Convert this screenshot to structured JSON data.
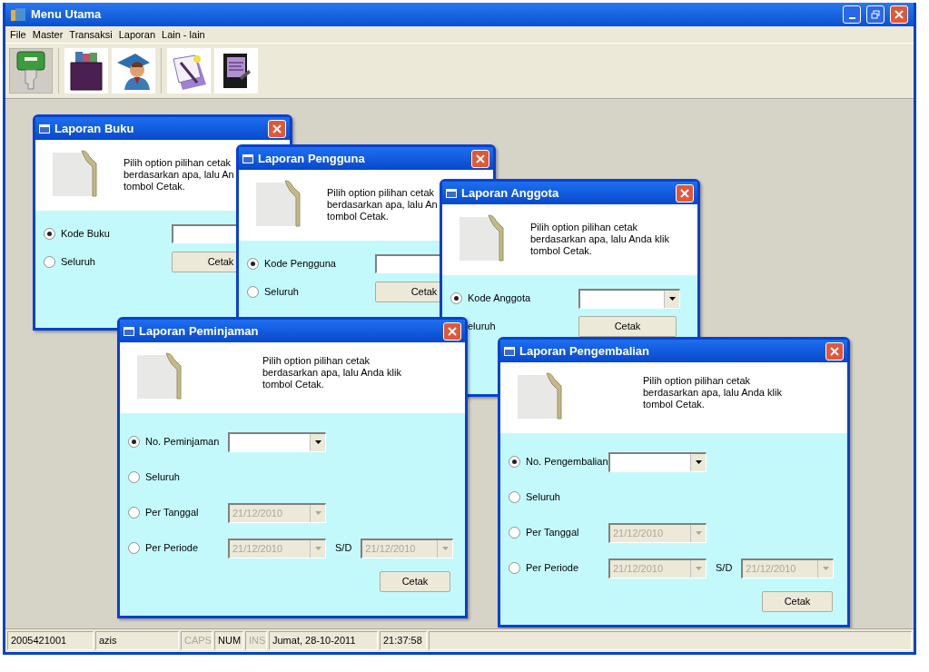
{
  "window": {
    "title": "Menu Utama"
  },
  "menu": [
    "File",
    "Master",
    "Transaksi",
    "Laporan",
    "Lain - lain"
  ],
  "toolbar": [
    {
      "kind": "key",
      "pressed": true
    },
    {
      "kind": "box",
      "pressed": false
    },
    {
      "kind": "person",
      "pressed": false
    },
    {
      "kind": "document",
      "pressed": false
    },
    {
      "kind": "book",
      "pressed": false
    }
  ],
  "dialogs": [
    {
      "kind": "compact",
      "title": "Laporan Buku",
      "description": "Pilih option pilihan cetak\nberdasarkan apa, lalu An\ntombol Cetak.",
      "options": [
        {
          "label": "Kode Buku",
          "selected": true,
          "fields": [
            {
              "kind": "text",
              "disabled": false
            }
          ]
        },
        {
          "label": "Seluruh",
          "selected": false
        }
      ],
      "button": "Cetak"
    },
    {
      "kind": "compact",
      "title": "Laporan Pengguna",
      "description": "Pilih option pilihan cetak\nberdasarkan apa, lalu An\ntombol Cetak.",
      "options": [
        {
          "label": "Kode Pengguna",
          "selected": true,
          "fields": [
            {
              "kind": "text",
              "disabled": false
            }
          ]
        },
        {
          "label": "Seluruh",
          "selected": false
        }
      ],
      "button": "Cetak"
    },
    {
      "kind": "compact",
      "title": "Laporan Anggota",
      "description": "Pilih option pilihan cetak\nberdasarkan apa, lalu Anda klik\ntombol Cetak.",
      "options": [
        {
          "label": "Kode Anggota",
          "selected": true,
          "fields": [
            {
              "kind": "combo",
              "disabled": false
            }
          ]
        },
        {
          "label": "eluruh"
        }
      ],
      "button": "Cetak"
    },
    {
      "kind": "wide",
      "title": "Laporan Peminjaman",
      "description": "Pilih option pilihan cetak\nberdasarkan apa, lalu Anda klik\ntombol Cetak.",
      "options": [
        {
          "label": "No. Peminjaman",
          "selected": true,
          "fields": [
            {
              "kind": "combo",
              "disabled": false
            }
          ]
        },
        {
          "label": "Seluruh",
          "selected": false
        },
        {
          "label": "Per Tanggal",
          "selected": false,
          "fields": [
            {
              "kind": "date",
              "value": "21/12/2010",
              "disabled": true
            }
          ]
        },
        {
          "label": "Per Periode",
          "selected": false,
          "fields": [
            {
              "kind": "date",
              "value": "21/12/2010",
              "disabled": true
            }
          ],
          "range_label": "S/D",
          "range_fields": [
            {
              "kind": "date",
              "value": "21/12/2010",
              "disabled": true
            }
          ]
        }
      ],
      "button": "Cetak"
    },
    {
      "kind": "wide",
      "title": "Laporan Pengembalian",
      "description": "Pilih option pilihan cetak\nberdasarkan apa, lalu Anda klik\ntombol Cetak.",
      "options": [
        {
          "label": "No. Pengembalian",
          "selected": true,
          "fields": [
            {
              "kind": "combo",
              "disabled": false
            }
          ]
        },
        {
          "label": "Seluruh",
          "selected": false
        },
        {
          "label": "Per Tanggal",
          "selected": false,
          "fields": [
            {
              "kind": "date",
              "value": "21/12/2010",
              "disabled": true
            }
          ]
        },
        {
          "label": "Per Periode",
          "selected": false,
          "fields": [
            {
              "kind": "date",
              "value": "21/12/2010",
              "disabled": true
            }
          ],
          "range_label": "S/D",
          "range_fields": [
            {
              "kind": "date",
              "value": "21/12/2010",
              "disabled": true
            }
          ]
        }
      ],
      "button": "Cetak"
    }
  ],
  "status_bar": [
    {
      "text": "2005421001",
      "disabled": false
    },
    {
      "text": "azis",
      "disabled": false
    },
    {
      "text": "CAPS",
      "disabled": true
    },
    {
      "text": "NUM",
      "disabled": false
    },
    {
      "text": "INS",
      "disabled": true
    },
    {
      "text": "Jumat, 28-10-2011",
      "disabled": false
    },
    {
      "text": "21:37:58",
      "disabled": false
    }
  ]
}
